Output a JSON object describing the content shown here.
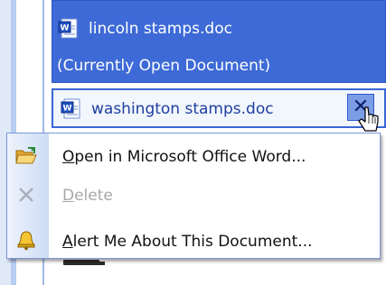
{
  "current_document": {
    "name": "lincoln stamps.doc",
    "subtitle": "(Currently Open Document)",
    "icon": "word-document-icon"
  },
  "hovered_document": {
    "name": "washington stamps.doc",
    "icon": "word-document-icon",
    "dropdown_icon": "close-x-icon"
  },
  "context_menu": {
    "items": [
      {
        "label_prefix": "",
        "underlined": "O",
        "label_rest": "pen in Microsoft Office Word...",
        "icon": "open-folder-icon",
        "enabled": true
      },
      {
        "label_prefix": "",
        "underlined": "D",
        "label_rest": "elete",
        "icon": "delete-x-icon",
        "enabled": false
      },
      {
        "label_prefix": "",
        "underlined": "A",
        "label_rest": "lert Me About This Document...",
        "icon": "alert-bell-icon",
        "enabled": true
      }
    ]
  },
  "colors": {
    "selection_blue": "#3d6ad6",
    "row_border": "#3a66d4",
    "disabled_text": "#a9a9a9"
  }
}
